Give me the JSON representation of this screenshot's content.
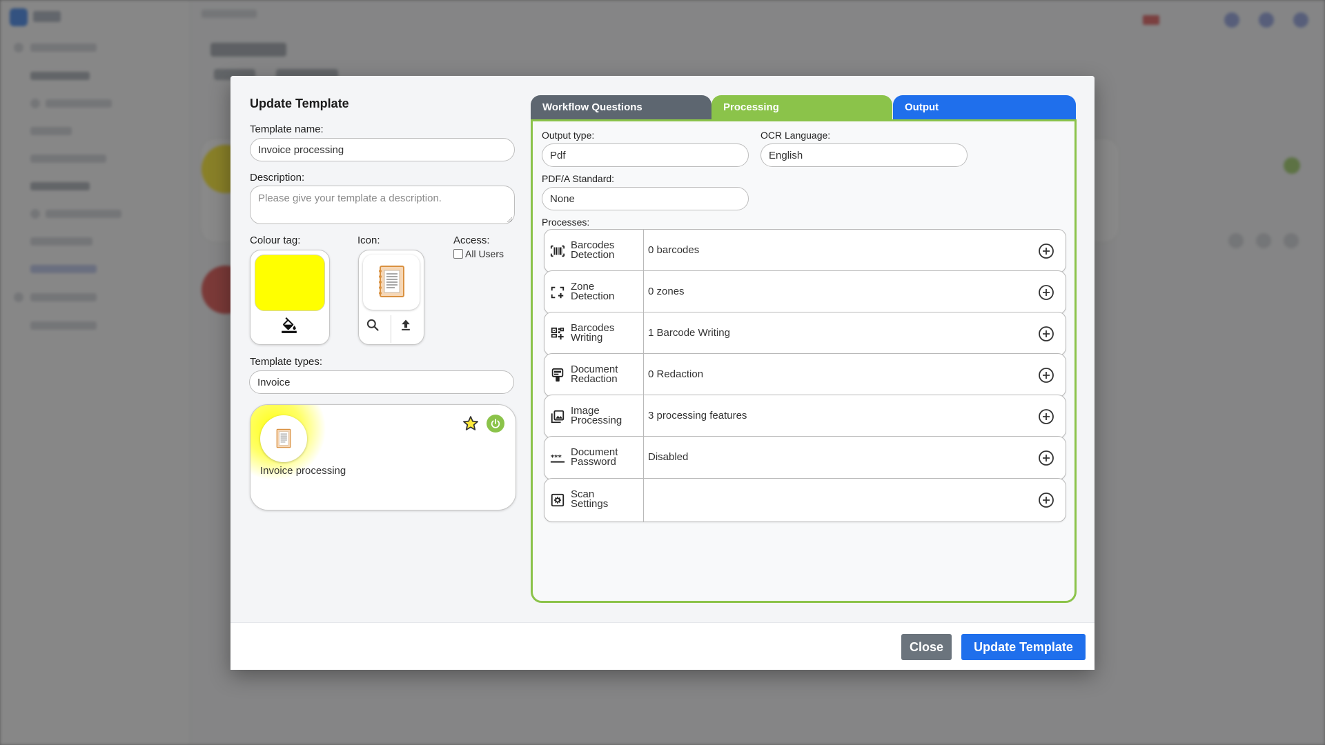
{
  "modal": {
    "title": "Update Template",
    "template_name_label": "Template name:",
    "template_name_value": "Invoice processing",
    "description_label": "Description:",
    "description_placeholder": "Please give your template a description.",
    "colour_tag_label": "Colour tag:",
    "colour_tag_color": "#ffff00",
    "icon_label": "Icon:",
    "access_label": "Access:",
    "access_all_users": "All Users",
    "access_all_users_checked": false,
    "template_types_label": "Template types:",
    "template_types_value": "Invoice",
    "preview": {
      "name": "Invoice processing",
      "favorite": false,
      "enabled": true
    }
  },
  "tabs": [
    {
      "label": "Workflow Questions",
      "color": "#5d6670"
    },
    {
      "label": "Processing",
      "color": "#8bc34a",
      "active": true
    },
    {
      "label": "Output",
      "color": "#1f6fec"
    }
  ],
  "processing": {
    "output_type_label": "Output type:",
    "output_type_value": "Pdf",
    "ocr_language_label": "OCR Language:",
    "ocr_language_value": "English",
    "pdfa_label": "PDF/A Standard:",
    "pdfa_value": "None",
    "processes_label": "Processes:",
    "processes": [
      {
        "line1": "Barcodes",
        "line2": "Detection",
        "value": "0 barcodes",
        "icon": "barcode-icon"
      },
      {
        "line1": "Zone",
        "line2": "Detection",
        "value": "0 zones",
        "icon": "zone-icon"
      },
      {
        "line1": "Barcodes",
        "line2": "Writing",
        "value": "1 Barcode Writing",
        "icon": "qr-code-icon"
      },
      {
        "line1": "Document",
        "line2": "Redaction",
        "value": "0 Redaction",
        "icon": "redaction-icon"
      },
      {
        "line1": "Image",
        "line2": "Processing",
        "value": "3 processing features",
        "icon": "image-icon"
      },
      {
        "line1": "Document",
        "line2": "Password",
        "value": "Disabled",
        "icon": "password-icon"
      },
      {
        "line1": "Scan",
        "line2": "Settings",
        "value": "",
        "icon": "scan-settings-icon"
      }
    ]
  },
  "footer": {
    "close_label": "Close",
    "update_label": "Update Template"
  },
  "colors": {
    "accent_green": "#8bc34a",
    "accent_blue": "#1f6fec",
    "tab_gray": "#5d6670"
  }
}
